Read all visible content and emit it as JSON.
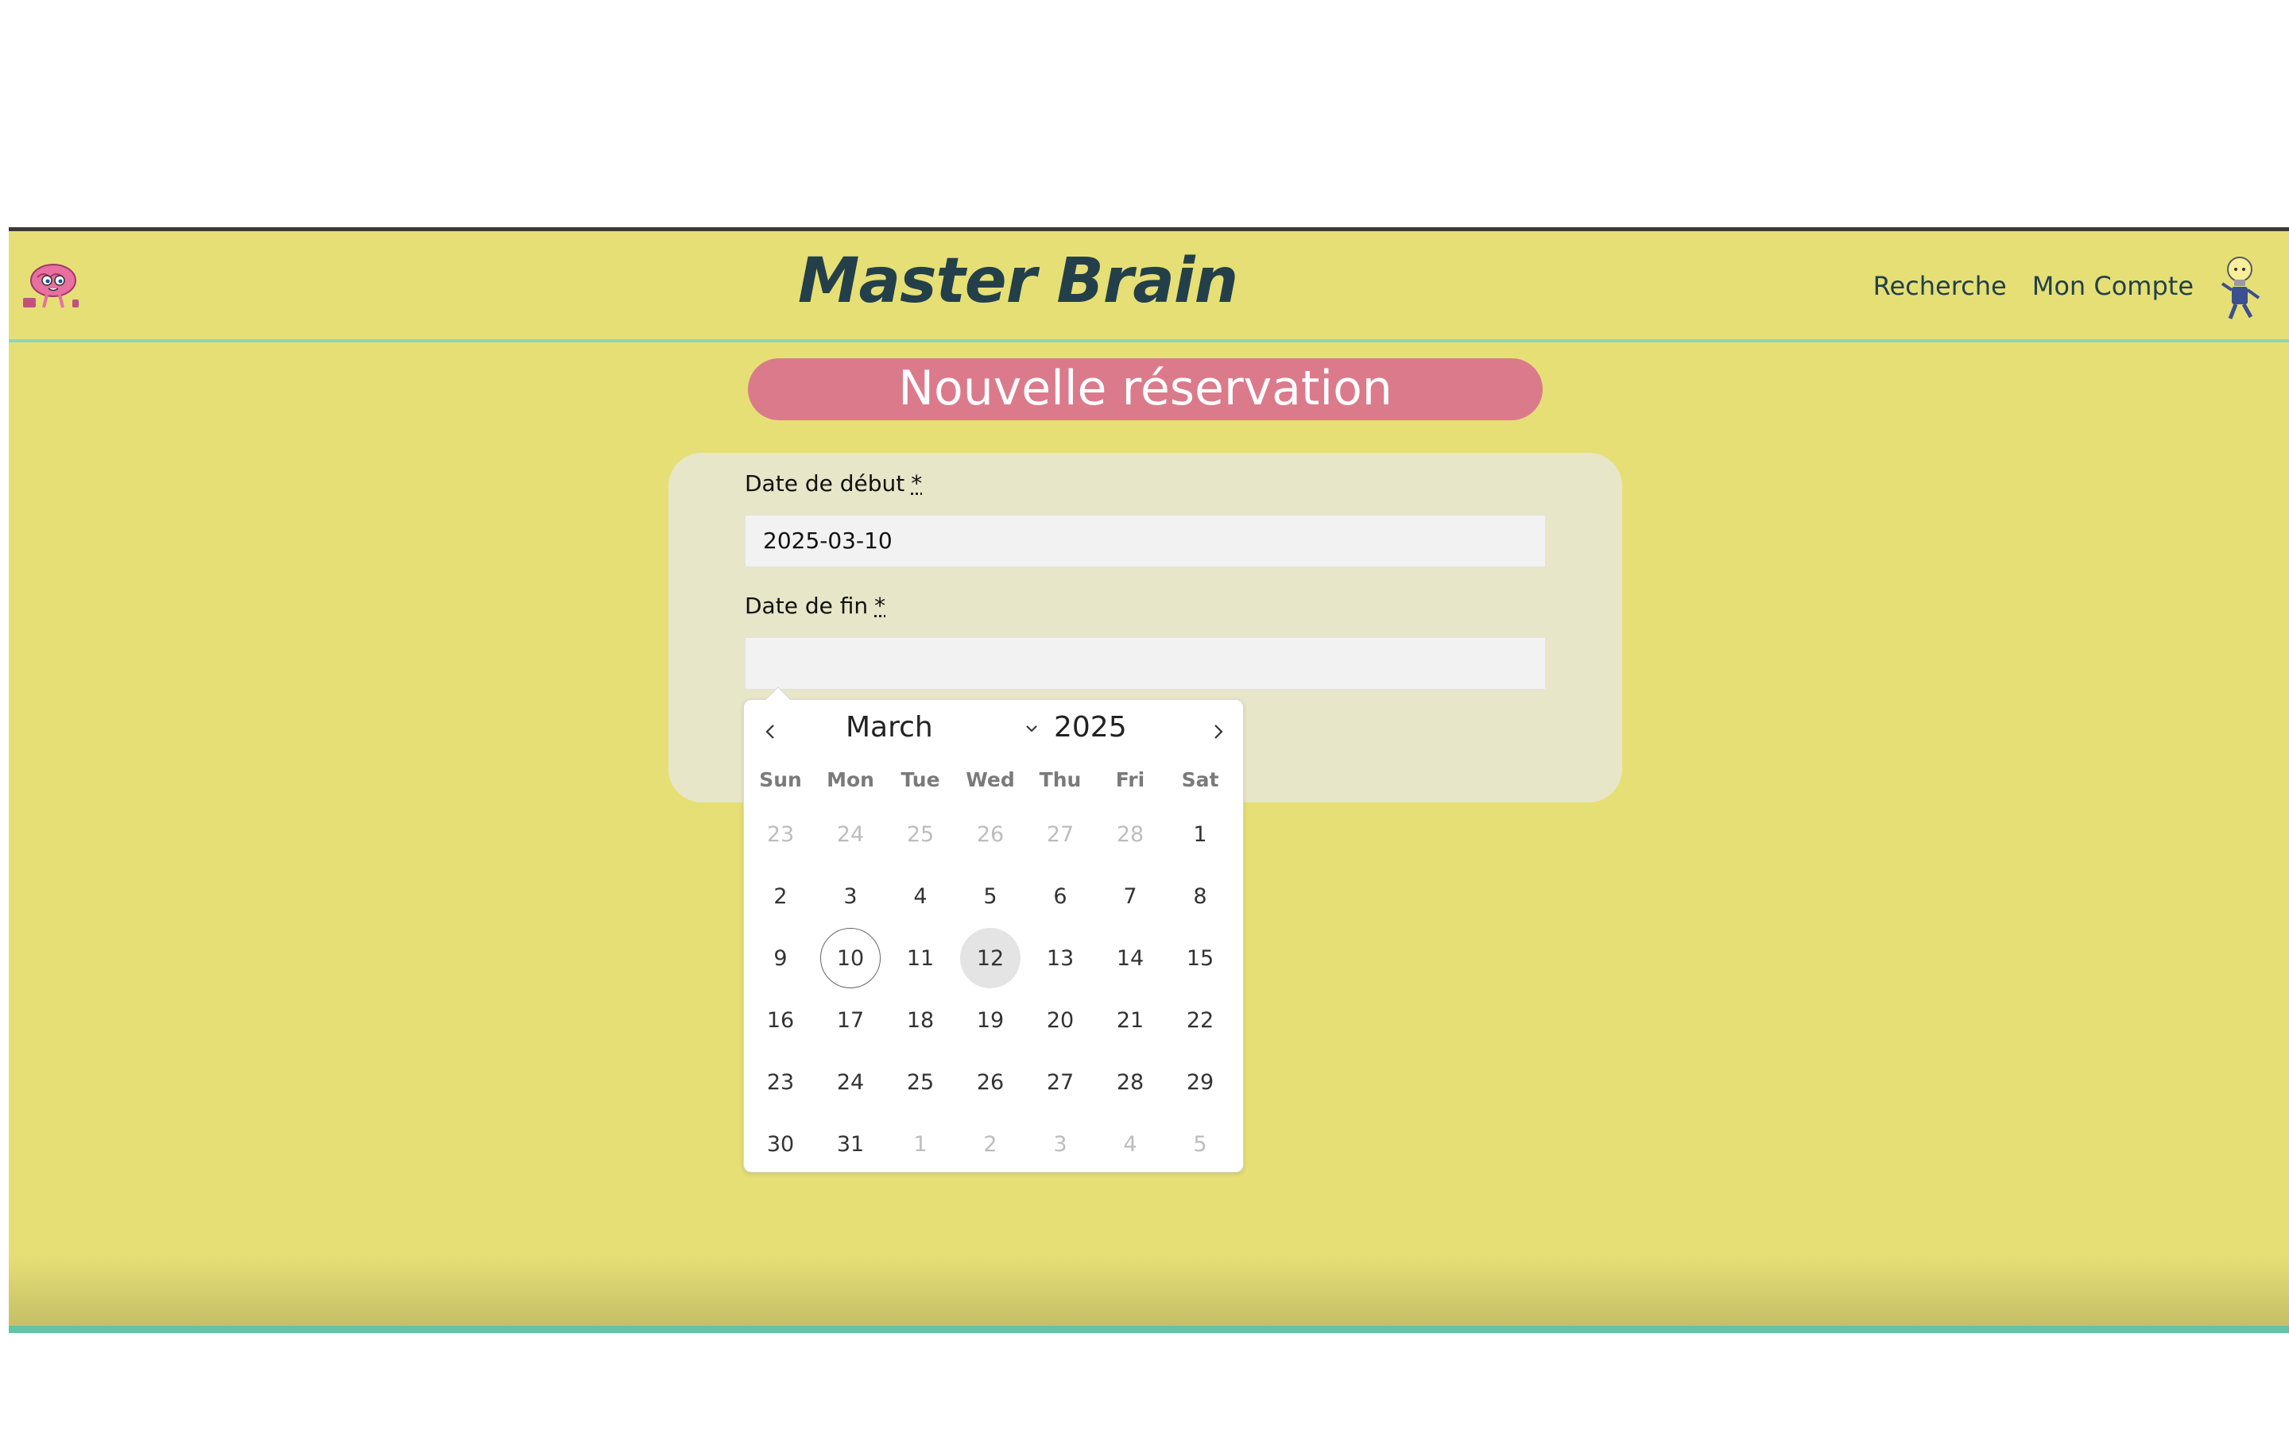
{
  "header": {
    "title": "Master Brain",
    "nav": [
      {
        "label": "Recherche"
      },
      {
        "label": "Mon Compte"
      }
    ],
    "logo_icon": "brain-mascot-icon",
    "avatar_icon": "lightbulb-character-icon"
  },
  "page": {
    "title": "Nouvelle réservation"
  },
  "form": {
    "start_label": "Date de début",
    "start_required": "*",
    "start_value": "2025-03-10",
    "end_label": "Date de fin",
    "end_required": "*",
    "end_value": ""
  },
  "datepicker": {
    "month": "March",
    "year": "2025",
    "weekdays": [
      "Sun",
      "Mon",
      "Tue",
      "Wed",
      "Thu",
      "Fri",
      "Sat"
    ],
    "days": [
      {
        "d": "23",
        "muted": true
      },
      {
        "d": "24",
        "muted": true
      },
      {
        "d": "25",
        "muted": true
      },
      {
        "d": "26",
        "muted": true
      },
      {
        "d": "27",
        "muted": true
      },
      {
        "d": "28",
        "muted": true
      },
      {
        "d": "1"
      },
      {
        "d": "2"
      },
      {
        "d": "3"
      },
      {
        "d": "4"
      },
      {
        "d": "5"
      },
      {
        "d": "6"
      },
      {
        "d": "7"
      },
      {
        "d": "8"
      },
      {
        "d": "9"
      },
      {
        "d": "10",
        "selected": true
      },
      {
        "d": "11"
      },
      {
        "d": "12",
        "today": true
      },
      {
        "d": "13"
      },
      {
        "d": "14"
      },
      {
        "d": "15"
      },
      {
        "d": "16"
      },
      {
        "d": "17"
      },
      {
        "d": "18"
      },
      {
        "d": "19"
      },
      {
        "d": "20"
      },
      {
        "d": "21"
      },
      {
        "d": "22"
      },
      {
        "d": "23"
      },
      {
        "d": "24"
      },
      {
        "d": "25"
      },
      {
        "d": "26"
      },
      {
        "d": "27"
      },
      {
        "d": "28"
      },
      {
        "d": "29"
      },
      {
        "d": "30"
      },
      {
        "d": "31"
      },
      {
        "d": "1",
        "muted": true
      },
      {
        "d": "2",
        "muted": true
      },
      {
        "d": "3",
        "muted": true
      },
      {
        "d": "4",
        "muted": true
      },
      {
        "d": "5",
        "muted": true
      }
    ]
  },
  "colors": {
    "background": "#e6df76",
    "title_pill": "#db7a8b",
    "brand_text": "#23404a",
    "accent_line": "#8ed6b4"
  }
}
